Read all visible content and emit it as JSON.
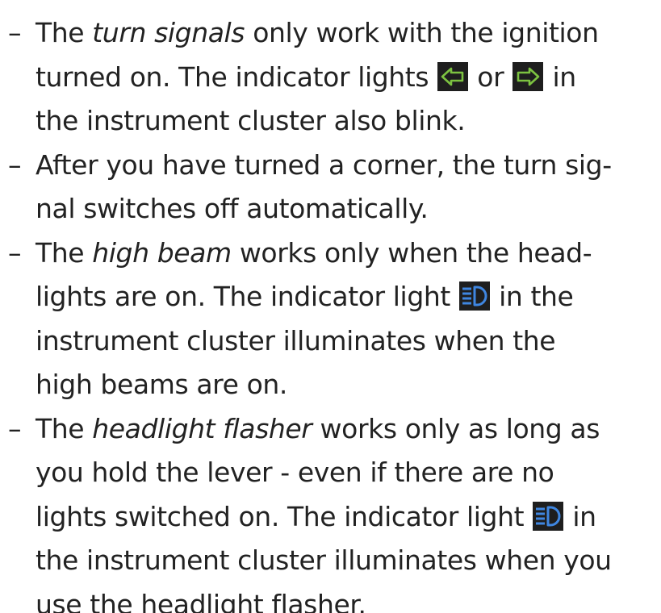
{
  "items": [
    {
      "dash": "–",
      "lines": [
        [
          "The ",
          {
            "em": "turn signals"
          },
          " only work with the ignition"
        ],
        [
          "turned on. The indicator lights ",
          {
            "icon": "turn-left"
          },
          " or ",
          {
            "icon": "turn-right"
          },
          " in"
        ],
        [
          "the instrument cluster also blink."
        ]
      ]
    },
    {
      "dash": "–",
      "lines": [
        [
          "After you have turned a corner, the turn sig-"
        ],
        [
          "nal switches off automatically."
        ]
      ]
    },
    {
      "dash": "–",
      "lines": [
        [
          "The ",
          {
            "em": "high beam"
          },
          " works only when the head-"
        ],
        [
          "lights are on. The indicator light ",
          {
            "icon": "high-beam"
          },
          " in the"
        ],
        [
          "instrument cluster illuminates when the"
        ],
        [
          "high beams are on."
        ]
      ]
    },
    {
      "dash": "–",
      "lines": [
        [
          "The ",
          {
            "em": "headlight flasher"
          },
          " works only as long as"
        ],
        [
          "you hold the lever - even if there are no"
        ],
        [
          "lights switched on. The indicator light ",
          {
            "icon": "high-beam"
          },
          " in"
        ],
        [
          "the instrument cluster illuminates when you"
        ],
        [
          "use the headlight flasher."
        ]
      ]
    }
  ],
  "icons": {
    "turn-left": {
      "name": "turn-signal-left-icon",
      "color": "#7cc241",
      "bg": "#1e1e1e"
    },
    "turn-right": {
      "name": "turn-signal-right-icon",
      "color": "#7cc241",
      "bg": "#1e1e1e"
    },
    "high-beam": {
      "name": "high-beam-icon",
      "color": "#3f86e0",
      "bg": "#1e1e1e"
    }
  }
}
